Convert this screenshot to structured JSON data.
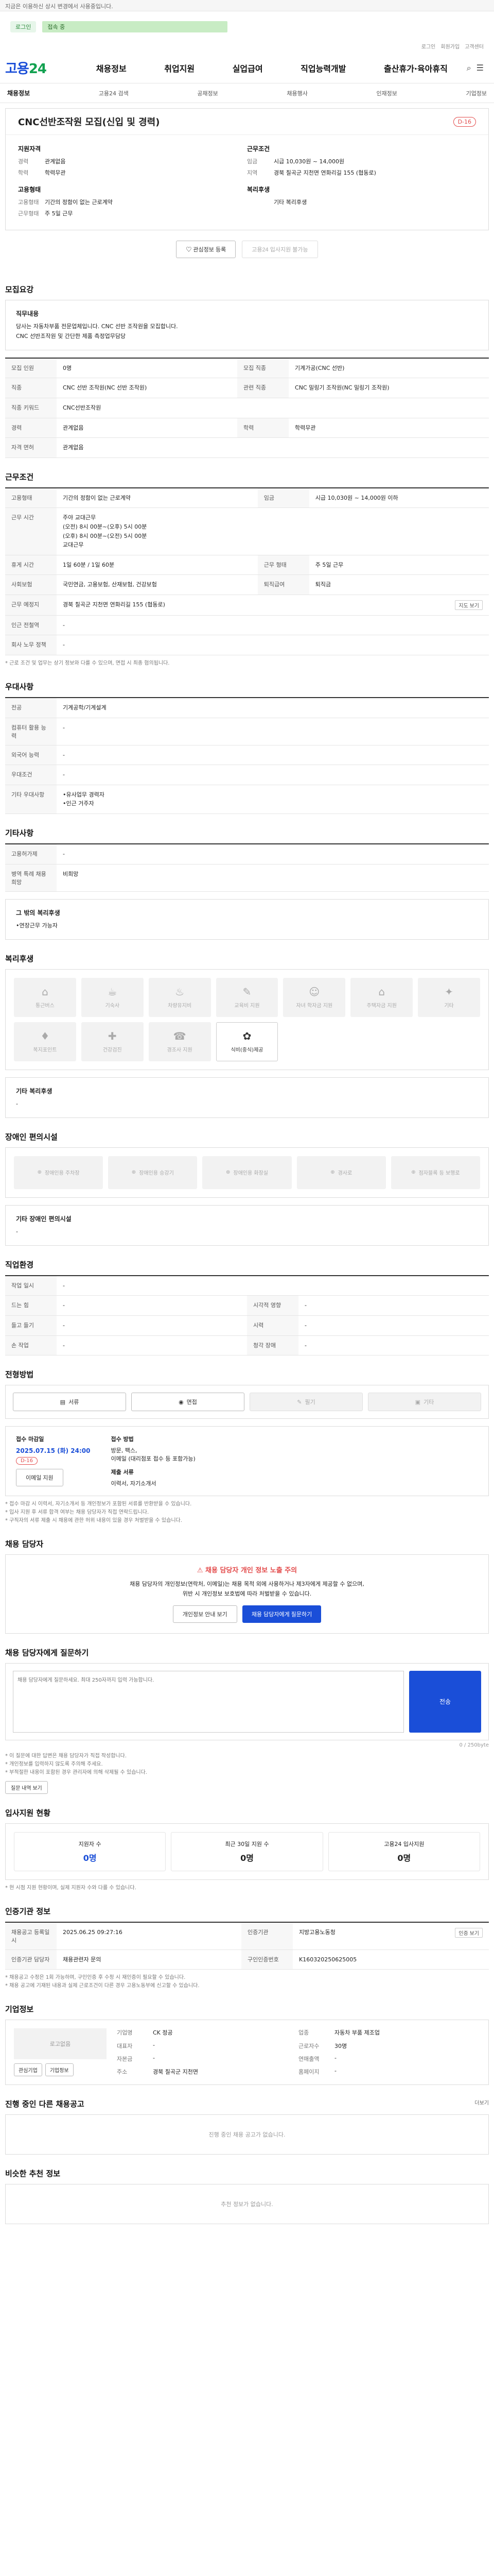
{
  "top_notice": "지금은 이용하신 상시 변경에서 사용중입니다.",
  "login": {
    "badge": "로그인",
    "bar_text": "접속 중"
  },
  "util_links": [
    "로그인",
    "회원가입",
    "고객센터"
  ],
  "brand": {
    "logo_main": "고용",
    "logo_num": "24"
  },
  "gnb": [
    "채용정보",
    "취업지원",
    "실업급여",
    "직업능력개발",
    "출산휴가·육아휴직"
  ],
  "subnav": {
    "title": "채용정보",
    "items": [
      "고용24 검색",
      "공채정보",
      "채용행사",
      "인재정보",
      "기업정보"
    ]
  },
  "job": {
    "title": "CNC선반조작원 모집(신입 및 경력)",
    "dday": "D-16",
    "left_h": "지원자격",
    "left_rows": [
      {
        "k": "경력",
        "v": "관계없음"
      },
      {
        "k": "학력",
        "v": "학력무관"
      }
    ],
    "left_h2": "고용형태",
    "left_rows2": [
      {
        "k": "고용형태",
        "v": "기간의 정함이 없는 근로계약"
      },
      {
        "k": "근무형태",
        "v": "주 5일 근무"
      }
    ],
    "right_h": "근무조건",
    "right_rows": [
      {
        "k": "임금",
        "v": "시급 10,030원 ~ 14,000원"
      },
      {
        "k": "지역",
        "v": "경북 칠곡군 지천면 연화리길 155 (협동로)"
      }
    ],
    "right_h2": "복리후생",
    "right_rows2": [
      {
        "k": "",
        "v": "기타 복리후생"
      }
    ],
    "btn_favorite": "관심정보 등록",
    "btn_share": "고용24 입사지원 불가능"
  },
  "sections": {
    "recruit": "모집요강",
    "work": "근무조건",
    "prefer": "우대사항",
    "etc": "기타사항",
    "welfare": "복리후생",
    "disability": "장애인 편의시설",
    "process": "전형방법",
    "contact": "채용 담당자",
    "qa": "채용 담당자에게 질문하기",
    "stats": "입사지원 현황",
    "agency": "인증기관 정보",
    "company": "기업정보",
    "other_jobs": "진행 중인 다른 채용공고",
    "similar": "비슷한 추천 정보"
  },
  "recruit_box": {
    "h": "직무내용",
    "body": "당사는 자동차부품 전문업체입니다. CNC 선반 조작원을 모집합니다.\nCNC 선반조작원 및 간단한 제품 측정업무담당"
  },
  "recruit_table": [
    {
      "k": "모집 인원",
      "v": "0명",
      "k2": "모집 직종",
      "v2": "기계가공(CNC 선반)"
    },
    {
      "k": "직종",
      "v": "CNC 선반 조작원(NC 선반 조작원)",
      "k2": "관련 직종",
      "v2": "CNC 밀링기 조작원(NC 밀링기 조작원)"
    },
    {
      "k": "직종 키워드",
      "v": "CNC선반조작원",
      "k2": "",
      "v2": ""
    },
    {
      "k": "경력",
      "v": "관계없음",
      "k2": "학력",
      "v2": "학력무관"
    },
    {
      "k": "자격 면허",
      "v": "관계없음",
      "k2": "",
      "v2": ""
    }
  ],
  "work_table": {
    "emp_type": "기간의 정함이 없는 근로계약",
    "wage": "시급 10,030원 ~ 14,000원 이하",
    "hours_h": "근무 시간",
    "hours": [
      "주야 교대근무",
      "(오전) 8시 00분~(오후) 5시 00분",
      "(오후) 8시 00분~(오전) 5시 00분",
      "교대근무"
    ],
    "break_h": "휴게 시간",
    "break": "1일 60분 / 1일 60분",
    "work_type_h": "근무 형태",
    "work_type": "주 5일 근무",
    "social_h": "사회보험",
    "social": "국민연금, 고용보험, 산재보험, 건강보험",
    "retire_h": "퇴직급여",
    "retire": "퇴직금",
    "place_h": "근무 예정지",
    "place": "경북 칠곡군 지천면 연화리길 155 (협동로)",
    "map_btn": "지도 보기",
    "station_h": "인근 전철역",
    "station": "-",
    "car_h": "회사 노무 정책",
    "car": "-",
    "note": "* 근로 조건 및 업무는 상기 정보와 다를 수 있으며, 면접 시 최종 협의됩니다."
  },
  "prefer_table": [
    {
      "k": "전공",
      "v": "기계공학/기계설계"
    },
    {
      "k": "컴퓨터 활용 능력",
      "v": "-"
    },
    {
      "k": "외국어 능력",
      "v": "-"
    },
    {
      "k": "우대조건",
      "v": "-"
    },
    {
      "k": "기타 우대사항",
      "v": "•유사업무 경력자\n•인근 거주자"
    }
  ],
  "etc_table": [
    {
      "k": "고용허가제",
      "v": "-"
    },
    {
      "k": "병역 특례 채용 희망",
      "v": "비희망"
    }
  ],
  "etc_box": {
    "h": "그 밖의 복리후생",
    "body": "•연장근무 가능자"
  },
  "welfare": [
    {
      "icon": "⌂",
      "name": "통근버스",
      "on": false
    },
    {
      "icon": "☕",
      "name": "기숙사",
      "on": false
    },
    {
      "icon": "♨",
      "name": "차량유지비",
      "on": false
    },
    {
      "icon": "✎",
      "name": "교육비 지원",
      "on": false
    },
    {
      "icon": "☺",
      "name": "자녀 학자금 지원",
      "on": false
    },
    {
      "icon": "⌂",
      "name": "주택자금 지원",
      "on": false
    },
    {
      "icon": "✦",
      "name": "기타",
      "on": false
    },
    {
      "icon": "♦",
      "name": "복지포인트",
      "on": false
    },
    {
      "icon": "✚",
      "name": "건강검진",
      "on": false
    },
    {
      "icon": "☎",
      "name": "경조사 지원",
      "on": false
    },
    {
      "icon": "✿",
      "name": "식비(중식)제공",
      "on": true
    }
  ],
  "welfare_box": {
    "h": "기타 복리후생",
    "body": "-"
  },
  "disability": [
    {
      "icon": "⊕",
      "name": "장애인용 주차장"
    },
    {
      "icon": "⊕",
      "name": "장애인용 승강기"
    },
    {
      "icon": "⊕",
      "name": "장애인용 화장실"
    },
    {
      "icon": "⊕",
      "name": "경사로"
    },
    {
      "icon": "⊕",
      "name": "점자블록 등 보행로"
    }
  ],
  "disability_box": {
    "h": "기타 장애인 편의시설",
    "body": "-"
  },
  "job_info_title": "직업환경",
  "job_env": [
    {
      "k": "작업 일시",
      "v": "-",
      "k2": "",
      "v2": ""
    },
    {
      "k": "드는 힘",
      "v": "-",
      "k2": "시각적 영향",
      "v2": "-"
    },
    {
      "k": "들고 들기",
      "v": "-",
      "k2": "시력",
      "v2": "-"
    },
    {
      "k": "손 작업",
      "v": "-",
      "k2": "청각 장애",
      "v2": "-"
    }
  ],
  "process_methods": [
    {
      "icon": "▤",
      "name": "서류",
      "on": true
    },
    {
      "icon": "◉",
      "name": "면접",
      "on": true
    },
    {
      "icon": "✎",
      "name": "필기",
      "on": false
    },
    {
      "icon": "▣",
      "name": "기타",
      "on": false
    }
  ],
  "apply": {
    "lbl1": "접수 마감일",
    "deadline": "2025.07.15 (화) 24:00",
    "dday": "D-16",
    "btn_email": "이메일 지원",
    "lbl2": "접수 방법",
    "method": "방문, 팩스,\n이메일 (대리점포 접수 등 포함가능)",
    "docs_lbl": "제출 서류",
    "docs": "이력서, 자기소개서"
  },
  "apply_notes": "* 접수 마감 시 이력서, 자기소개서 등 개인정보가 포함된 서류를 반환받을 수 있습니다.\n* 입사 지원 후 서류 합격 여부는 채용 담당자가 직접 연락드립니다.\n* 구직자의 서류 제출 시 채용에 관한 허위 내용이 있을 경우 처벌받을 수 있습니다.",
  "contact": {
    "warn": "채용 담당자 개인 정보 노출 주의",
    "body": "채용 담당자의 개인정보(연락처, 이메일)는 채용 목적 외에 사용하거나 제3자에게 제공할 수 없으며,\n위반 시 개인정보 보호법에 따라 처벌받을 수 있습니다.",
    "btn1": "개인정보 안내 보기",
    "btn2": "채용 담당자에게 질문하기"
  },
  "qa": {
    "placeholder": "채용 담당자에게 질문하세요. 최대 250자까지 입력 가능합니다.",
    "send": "전송",
    "counter": "0 / 250byte",
    "notes": "* 이 질문에 대한 답변은 채용 담당자가 직접 작성합니다.\n* 개인정보를 입력하지 않도록 주의해 주세요.\n* 부적절한 내용이 포함된 경우 관리자에 의해 삭제될 수 있습니다.",
    "more_btn": "질문 내역 보기"
  },
  "stats": [
    {
      "label": "지원자 수",
      "n": "0명",
      "blue": true
    },
    {
      "label": "최근 30일 지원 수",
      "n": "0명",
      "blue": false
    },
    {
      "label": "고용24 입사지원",
      "n": "0명",
      "blue": false
    }
  ],
  "stats_note": "* 현 시점 지원 현황이며, 실제 지원자 수와 다를 수 있습니다.",
  "agency_table": [
    {
      "k": "채용공고 등록일시",
      "v": "2025.06.25 09:27:16",
      "k2": "인증기관",
      "v2": "지방고용노동청",
      "btn": "인증 보기"
    },
    {
      "k": "인증기관 담당자",
      "v": "채용관련자 문의",
      "k2": "구인인증번호",
      "v2": "K160320250625005"
    }
  ],
  "agency_notes": "* 채용공고 수정은 1회 가능하며, 구인인증 후 수정 시 재인증이 필요할 수 있습니다.\n* 채용 공고에 기재된 내용과 실제 근로조건이 다른 경우 고용노동부에 신고할 수 있습니다.",
  "company": {
    "logo": "로고없음",
    "rows": [
      {
        "k": "기업명",
        "v": "CK 정공",
        "k2": "업종",
        "v2": "자동차 부품 제조업"
      },
      {
        "k": "대표자",
        "v": "-",
        "k2": "근로자수",
        "v2": "30명"
      },
      {
        "k": "자본금",
        "v": "-",
        "k2": "연매출액",
        "v2": "-"
      },
      {
        "k": "주소",
        "v": "경북 칠곡군 지천면",
        "k2": "홈페이지",
        "v2": "-"
      }
    ],
    "btns": [
      "관심기업",
      "기업정보"
    ]
  },
  "other_jobs_empty": "진행 중인 채용 공고가 없습니다.",
  "similar_empty": "추천 정보가 없습니다.",
  "more_label": "더보기"
}
